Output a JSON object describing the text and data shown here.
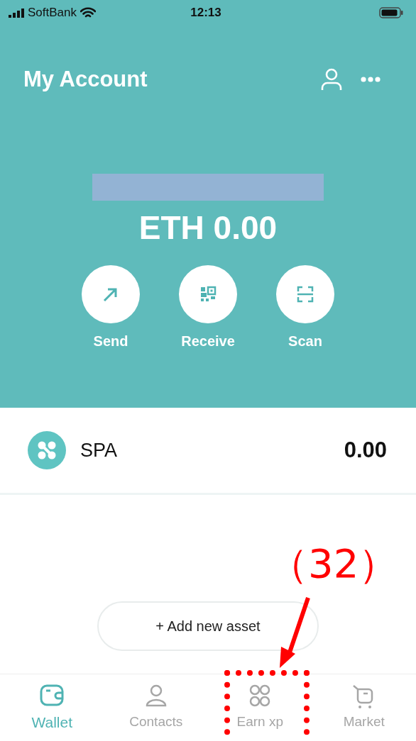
{
  "status_bar": {
    "carrier": "SoftBank",
    "time": "12:13"
  },
  "header": {
    "title": "My Account"
  },
  "balance": {
    "amount": "ETH 0.00"
  },
  "actions": [
    {
      "label": "Send",
      "kind": "send"
    },
    {
      "label": "Receive",
      "kind": "receive"
    },
    {
      "label": "Scan",
      "kind": "scan"
    }
  ],
  "assets": [
    {
      "name": "SPA",
      "amount": "0.00"
    }
  ],
  "add_button": {
    "label": "+ Add new asset"
  },
  "tabs": [
    {
      "label": "Wallet",
      "kind": "wallet",
      "selected": true
    },
    {
      "label": "Contacts",
      "kind": "contacts",
      "selected": false
    },
    {
      "label": "Earn xp",
      "kind": "earn",
      "selected": false
    },
    {
      "label": "Market",
      "kind": "market",
      "selected": false
    }
  ],
  "annotation": {
    "label": "（32）"
  }
}
